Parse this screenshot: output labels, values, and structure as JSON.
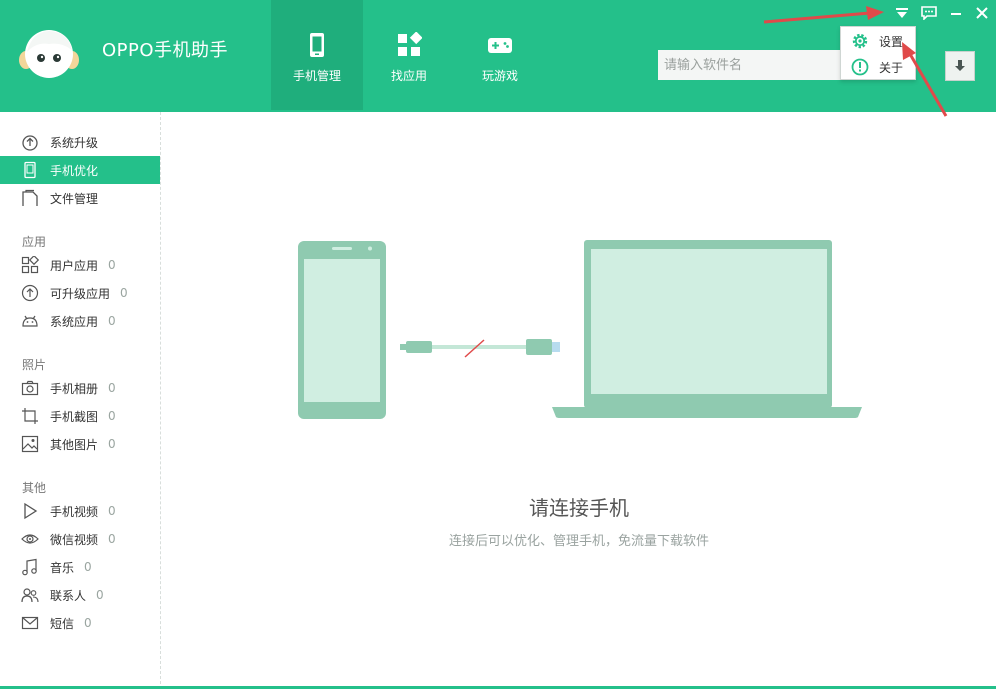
{
  "app": {
    "title": "OPPO手机助手"
  },
  "nav": [
    {
      "label": "手机管理",
      "icon": "phone-icon",
      "active": true
    },
    {
      "label": "找应用",
      "icon": "apps-icon",
      "active": false
    },
    {
      "label": "玩游戏",
      "icon": "gamepad-icon",
      "active": false
    }
  ],
  "search": {
    "placeholder": "请输入软件名",
    "value": ""
  },
  "menu": [
    {
      "label": "设置",
      "icon": "gear-icon"
    },
    {
      "label": "关于",
      "icon": "info-icon"
    }
  ],
  "window_controls": [
    "dropdown-icon",
    "message-icon",
    "minimize-icon",
    "close-icon"
  ],
  "sidebar": {
    "top_items": [
      {
        "label": "系统升级",
        "icon": "upgrade-icon",
        "active": false
      },
      {
        "label": "手机优化",
        "icon": "optimize-icon",
        "active": true
      },
      {
        "label": "文件管理",
        "icon": "folder-icon",
        "active": false
      }
    ],
    "sections": [
      {
        "title": "应用",
        "items": [
          {
            "label": "用户应用",
            "count": "0",
            "icon": "grid-icon"
          },
          {
            "label": "可升级应用",
            "count": "0",
            "icon": "arrow-up-circle-icon"
          },
          {
            "label": "系统应用",
            "count": "0",
            "icon": "android-icon"
          }
        ]
      },
      {
        "title": "照片",
        "items": [
          {
            "label": "手机相册",
            "count": "0",
            "icon": "camera-icon"
          },
          {
            "label": "手机截图",
            "count": "0",
            "icon": "crop-icon"
          },
          {
            "label": "其他图片",
            "count": "0",
            "icon": "image-icon"
          }
        ]
      },
      {
        "title": "其他",
        "items": [
          {
            "label": "手机视频",
            "count": "0",
            "icon": "play-icon"
          },
          {
            "label": "微信视频",
            "count": "0",
            "icon": "eye-icon"
          },
          {
            "label": "音乐",
            "count": "0",
            "icon": "music-icon"
          },
          {
            "label": "联系人",
            "count": "0",
            "icon": "contacts-icon"
          },
          {
            "label": "短信",
            "count": "0",
            "icon": "mail-icon"
          }
        ]
      }
    ]
  },
  "main": {
    "title": "请连接手机",
    "subtitle": "连接后可以优化、管理手机，免流量下载软件"
  },
  "colors": {
    "brand": "#24c08a",
    "illustration": "#8fcab0",
    "illustration_light": "#d0eee1",
    "annotation_arrow": "#e04a4a"
  }
}
